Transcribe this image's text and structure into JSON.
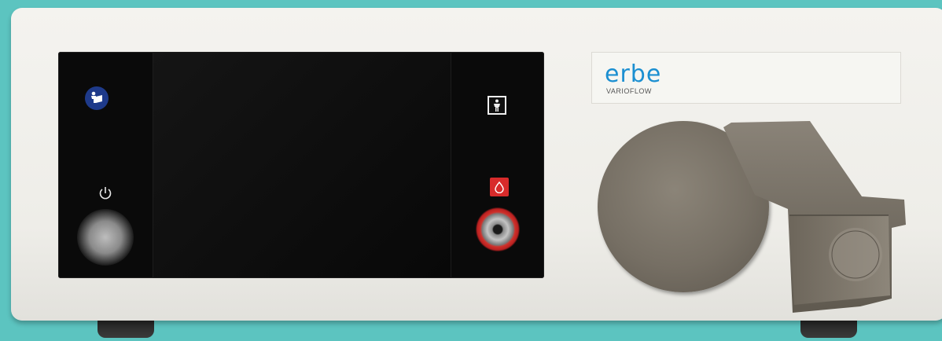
{
  "device": {
    "brand": "erbe",
    "model": "VARIOFLOW"
  },
  "colors": {
    "background": "#5cc4c0",
    "housing": "#f1f0eb",
    "panel": "#0a0a0a",
    "brand_blue": "#1b8fd1",
    "accent_red": "#d82b2b",
    "pump_metal": "#7a7368"
  },
  "icons": {
    "manual": "read-instructions-icon",
    "patient": "patient-type-bf-icon",
    "power": "power-icon",
    "irrigation": "irrigation-drop-icon"
  }
}
